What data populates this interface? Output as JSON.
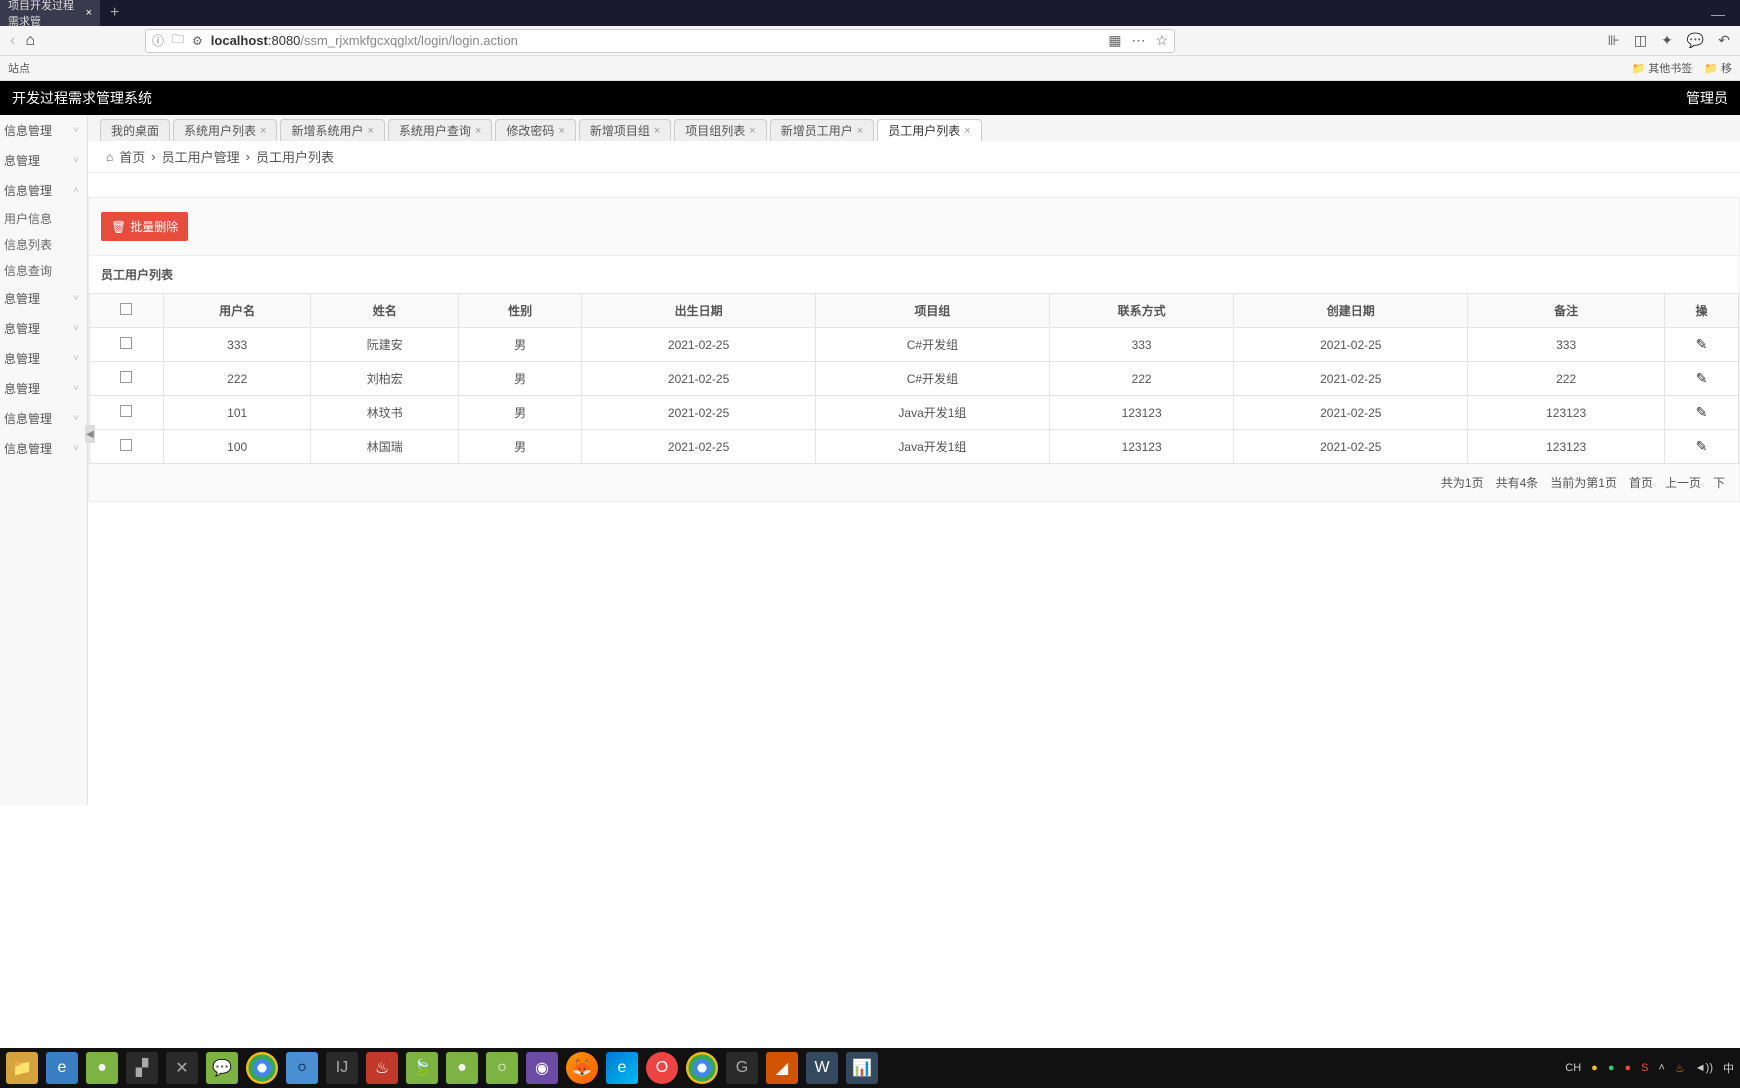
{
  "browser": {
    "tab_title": "项目开发过程需求管",
    "url_host": "localhost",
    "url_port": ":8080",
    "url_path": "/ssm_rjxmkfgcxqglxt/login/login.action",
    "bookmark_left": "站点",
    "bookmark_other": "其他书签",
    "bookmark_move": "移"
  },
  "app": {
    "title": "开发过程需求管理系统",
    "user_label": "管理员"
  },
  "sidebar": {
    "items": [
      {
        "label": "信息管理",
        "chev": "down"
      },
      {
        "label": "息管理",
        "chev": "down"
      },
      {
        "label": "信息管理",
        "chev": "up"
      }
    ],
    "subs": [
      {
        "label": "用户信息"
      },
      {
        "label": "信息列表"
      },
      {
        "label": "信息查询"
      }
    ],
    "items2": [
      {
        "label": "息管理",
        "chev": "down"
      },
      {
        "label": "息管理",
        "chev": "down"
      },
      {
        "label": "息管理",
        "chev": "down"
      },
      {
        "label": "息管理",
        "chev": "down"
      },
      {
        "label": "信息管理",
        "chev": "down"
      },
      {
        "label": "信息管理",
        "chev": "down"
      }
    ]
  },
  "tabs": [
    {
      "label": "我的桌面",
      "closable": false
    },
    {
      "label": "系统用户列表",
      "closable": true
    },
    {
      "label": "新增系统用户",
      "closable": true
    },
    {
      "label": "系统用户查询",
      "closable": true
    },
    {
      "label": "修改密码",
      "closable": true
    },
    {
      "label": "新增项目组",
      "closable": true
    },
    {
      "label": "项目组列表",
      "closable": true
    },
    {
      "label": "新增员工用户",
      "closable": true
    },
    {
      "label": "员工用户列表",
      "closable": true,
      "active": true
    }
  ],
  "breadcrumb": {
    "home": "首页",
    "level1": "员工用户管理",
    "level2": "员工用户列表"
  },
  "panel": {
    "batch_delete": "批量删除",
    "title": "员工用户列表"
  },
  "table": {
    "headers": [
      "用户名",
      "姓名",
      "性别",
      "出生日期",
      "项目组",
      "联系方式",
      "创建日期",
      "备注",
      "操"
    ],
    "rows": [
      {
        "username": "333",
        "name": "阮建安",
        "gender": "男",
        "birth": "2021-02-25",
        "group": "C#开发组",
        "contact": "333",
        "created": "2021-02-25",
        "remark": "333"
      },
      {
        "username": "222",
        "name": "刘柏宏",
        "gender": "男",
        "birth": "2021-02-25",
        "group": "C#开发组",
        "contact": "222",
        "created": "2021-02-25",
        "remark": "222"
      },
      {
        "username": "101",
        "name": "林玟书",
        "gender": "男",
        "birth": "2021-02-25",
        "group": "Java开发1组",
        "contact": "123123",
        "created": "2021-02-25",
        "remark": "123123"
      },
      {
        "username": "100",
        "name": "林国瑞",
        "gender": "男",
        "birth": "2021-02-25",
        "group": "Java开发1组",
        "contact": "123123",
        "created": "2021-02-25",
        "remark": "123123"
      }
    ]
  },
  "pager": {
    "total_pages": "共为1页",
    "total_items": "共有4条",
    "current": "当前为第1页",
    "first": "首页",
    "prev": "上一页",
    "next": "下"
  },
  "tray": {
    "ime": "CH",
    "time_icons": "◄))"
  }
}
